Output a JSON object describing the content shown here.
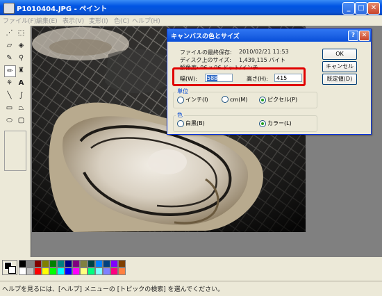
{
  "window": {
    "title": "P1010404.JPG - ペイント"
  },
  "menu": [
    "ファイル(F)",
    "編集(E)",
    "表示(V)",
    "変形(I)",
    "色(C)",
    "ヘルプ(H)"
  ],
  "tools": [
    "select-free",
    "select-rect",
    "eraser",
    "fill",
    "picker",
    "magnifier",
    "pencil",
    "brush",
    "airbrush",
    "text",
    "line",
    "curve",
    "rect",
    "polygon",
    "ellipse",
    "rounded-rect"
  ],
  "dialog": {
    "title": "キャンバスの色とサイズ",
    "last_saved": "ファイルの最終保存:",
    "last_saved_value": "2010/02/21 11:53",
    "disk_size": "ディスク上のサイズ:",
    "disk_size_value": "1,439,115 バイト",
    "resolution": "解像度: 96 x 96 ドット/インチ",
    "width_label": "幅(W):",
    "width_value": "588",
    "height_label": "高さ(H):",
    "height_value": "415",
    "units_group": "単位",
    "unit_inch": "インチ(I)",
    "unit_cm": "cm(M)",
    "unit_pixel": "ピクセル(P)",
    "color_group": "色",
    "color_mono": "白黒(B)",
    "color_color": "カラー(L)",
    "ok": "OK",
    "cancel": "キャンセル",
    "default": "既定値(D)"
  },
  "palette_colors": [
    "#000000",
    "#808080",
    "#800000",
    "#808000",
    "#008000",
    "#008080",
    "#000080",
    "#800080",
    "#808040",
    "#004040",
    "#0080FF",
    "#004080",
    "#8000FF",
    "#804000",
    "#FFFFFF",
    "#C0C0C0",
    "#FF0000",
    "#FFFF00",
    "#00FF00",
    "#00FFFF",
    "#0000FF",
    "#FF00FF",
    "#FFFF80",
    "#00FF80",
    "#80FFFF",
    "#8080FF",
    "#FF0080",
    "#FF8040"
  ],
  "status": "ヘルプを見るには、[ヘルプ] メニューの [トピックの検索] を選んでください。"
}
